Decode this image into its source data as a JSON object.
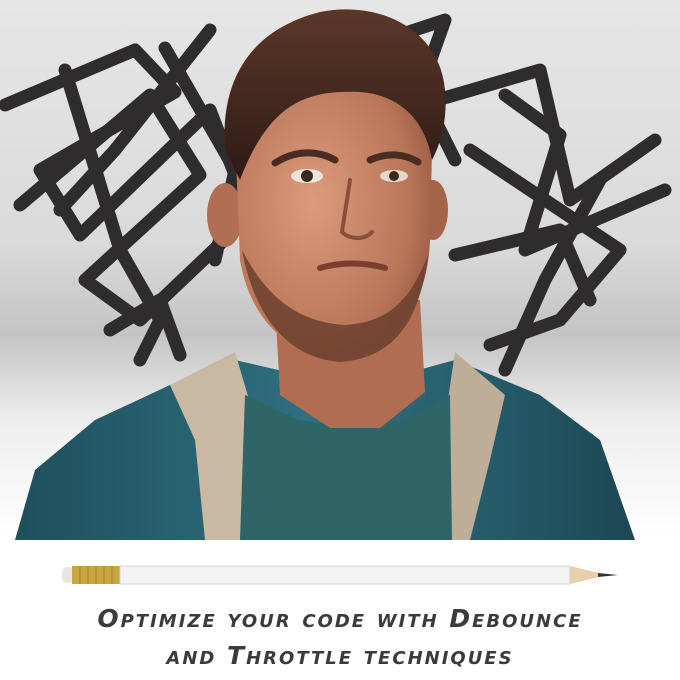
{
  "caption": {
    "line1": "Optimize your code with Debounce",
    "line2": "and Throttle techniques"
  },
  "colors": {
    "scribble": "#2f2c2e",
    "caption_text": "#3b3a3d",
    "jacket": "#2c6a77",
    "tshirt": "#2f6566",
    "skin": "#c98a6c",
    "hair": "#4a2c22",
    "hood": "#c9b9a3",
    "pencil_body": "#f3f3f3",
    "ferrule": "#c8a53e"
  },
  "icons": {
    "pencil": "pencil-icon",
    "scribble": "scribble-decoration"
  }
}
